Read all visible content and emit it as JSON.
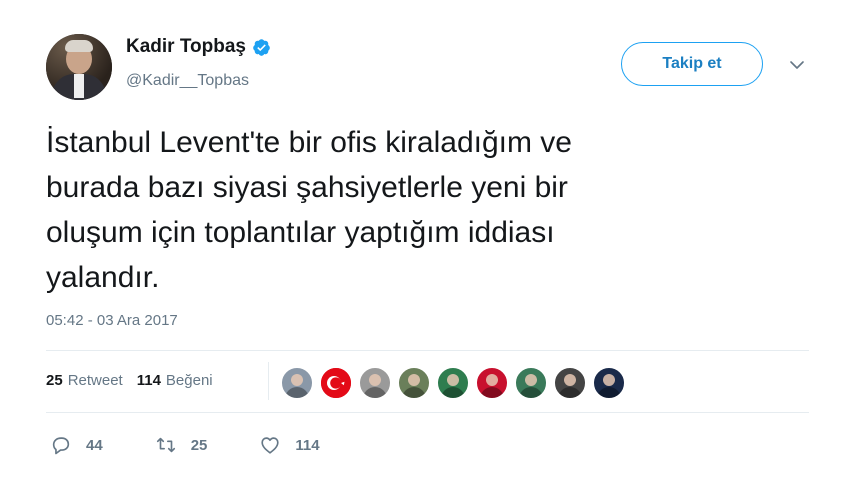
{
  "author": {
    "display_name": "Kadir Topbaş",
    "handle": "@Kadir__Topbas",
    "verified": true
  },
  "follow_button_label": "Takip et",
  "tweet": {
    "lines": [
      "İstanbul Levent'te bir ofis kiraladığım ve",
      "burada bazı siyasi şahsiyetlerle yeni bir",
      "oluşum için toplantılar yaptığım iddiası",
      "yalandır."
    ],
    "timestamp": "05:42 - 03 Ara 2017"
  },
  "stats": {
    "retweet_count": "25",
    "retweet_label": "Retweet",
    "like_count": "114",
    "like_label": "Beğeni"
  },
  "likers": [
    {
      "name": "liker-1",
      "color": "#8a98a8"
    },
    {
      "name": "liker-2-turkish-flag",
      "color": "#e30a17"
    },
    {
      "name": "liker-3",
      "color": "#9a9a9a"
    },
    {
      "name": "liker-4",
      "color": "#6a7f5a"
    },
    {
      "name": "liker-5",
      "color": "#2e7d4f"
    },
    {
      "name": "liker-6",
      "color": "#c8102e"
    },
    {
      "name": "liker-7",
      "color": "#3a7a5a"
    },
    {
      "name": "liker-8",
      "color": "#444444"
    },
    {
      "name": "liker-9",
      "color": "#1a2a4a"
    }
  ],
  "actions": {
    "reply_count": "44",
    "retweet_count": "25",
    "like_count": "114"
  },
  "colors": {
    "accent": "#1da1f2",
    "muted_text": "#657786",
    "divider": "#e6ecf0"
  }
}
